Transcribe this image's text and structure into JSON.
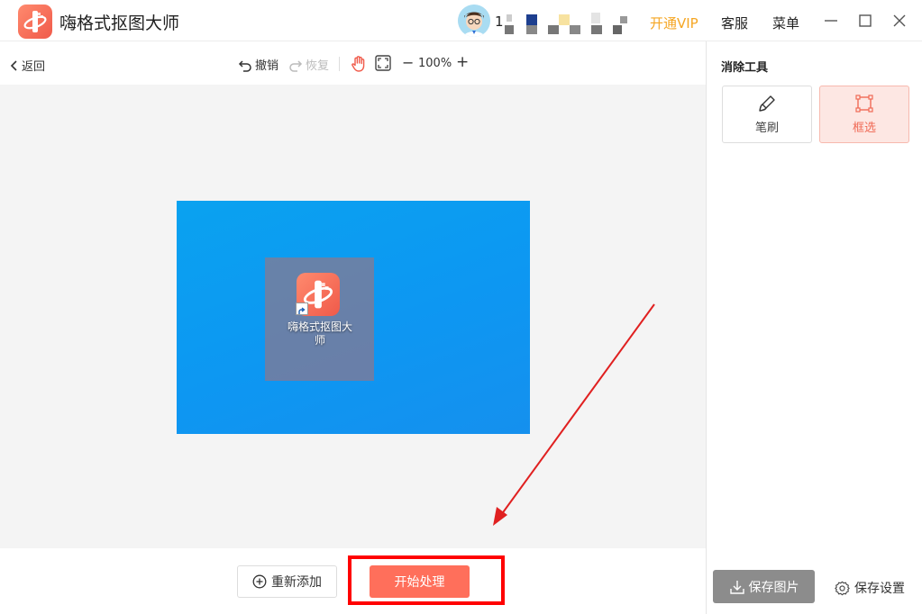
{
  "app": {
    "title": "嗨格式抠图大师",
    "logo_icon": "app-logo-icon"
  },
  "header": {
    "username_prefix": "1",
    "vip_label": "开通VIP",
    "service_label": "客服",
    "menu_label": "菜单",
    "vip_color": "#f5a623"
  },
  "toolbar": {
    "back_label": "返回",
    "undo_label": "撤销",
    "redo_label": "恢复",
    "zoom_level": "100%",
    "zoom_out": "−",
    "zoom_in": "+"
  },
  "canvas": {
    "desktop_icon_label": "嗨格式抠图大师"
  },
  "bottom": {
    "readd_label": "重新添加",
    "start_label": "开始处理",
    "start_color": "#ff6f5b",
    "highlight_color": "#ff0000"
  },
  "panel": {
    "title": "消除工具",
    "tools": [
      {
        "label": "笔刷",
        "icon": "brush-icon",
        "selected": false
      },
      {
        "label": "框选",
        "icon": "box-select-icon",
        "selected": true
      }
    ],
    "save_image_label": "保存图片",
    "save_settings_label": "保存设置"
  }
}
